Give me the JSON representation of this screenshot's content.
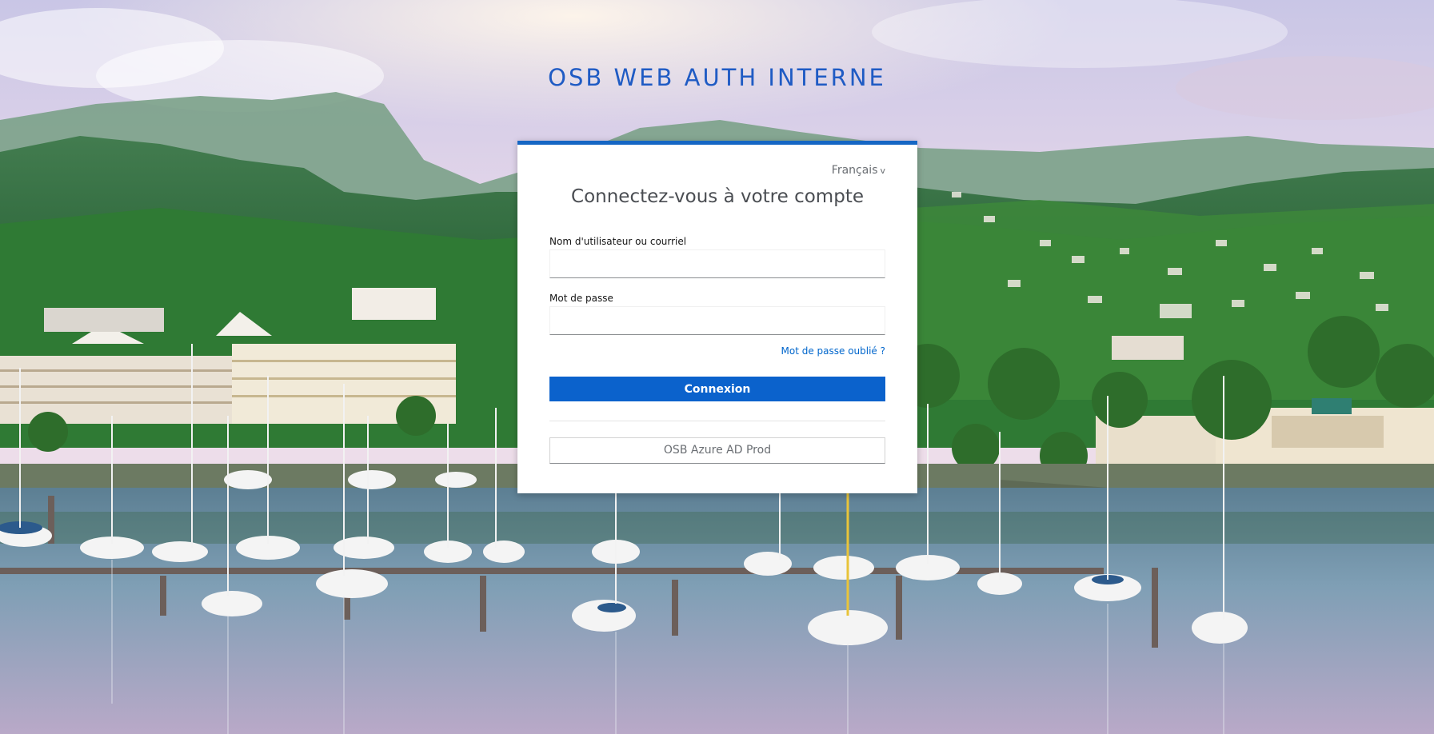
{
  "realm": {
    "title": "OSB WEB AUTH INTERNE"
  },
  "login": {
    "locale": "Français",
    "locale_caret": "v",
    "heading": "Connectez-vous à votre compte",
    "username_label": "Nom d'utilisateur ou courriel",
    "username_value": "",
    "password_label": "Mot de passe",
    "password_value": "",
    "forgot_password": "Mot de passe oublié ?",
    "submit_label": "Connexion",
    "identity_providers": [
      {
        "label": "OSB Azure AD Prod"
      }
    ]
  },
  "colors": {
    "accent": "#0b62cc",
    "title": "#1f5bc4",
    "link": "#0066cc"
  }
}
